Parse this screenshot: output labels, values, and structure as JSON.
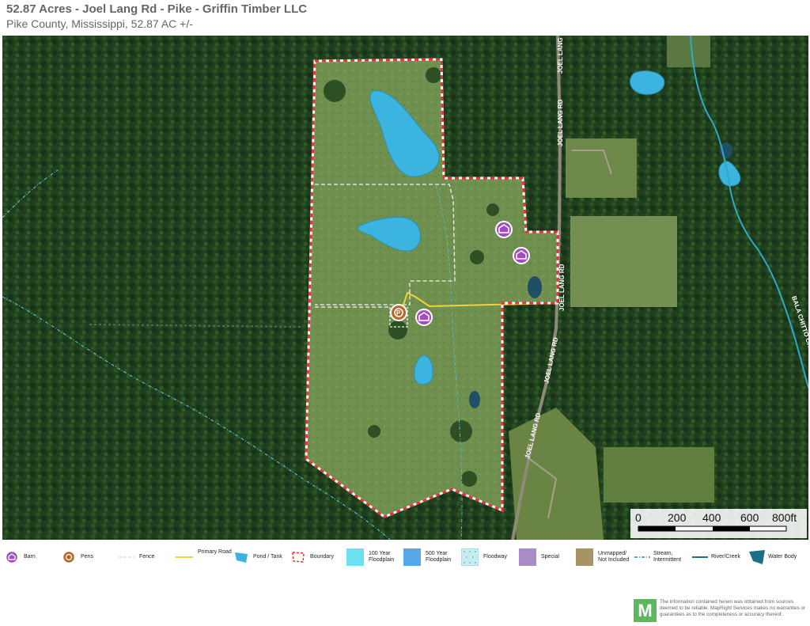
{
  "header": {
    "title": "52.87 Acres - Joel Lang Rd - Pike - Griffin Timber LLC",
    "subtitle": "Pike County, Mississippi, 52.87 AC +/-"
  },
  "map": {
    "road_labels": [
      "JOEL LANG",
      "JOEL LANG RD",
      "JOEL LANG RD",
      "JOEL LANG RD",
      "JOEL LANG RD"
    ],
    "stream_label": "BALA CHITTO CREEK",
    "scale": {
      "ticks": [
        "0",
        "200",
        "400",
        "600",
        "800ft"
      ]
    },
    "colors": {
      "boundary": "#e8323c",
      "pond": "#3cb4e0",
      "primary_road": "#f2d23c",
      "barn": "#a14dbb",
      "pens": "#b36b2c",
      "stream": "#2fa9c9"
    }
  },
  "legend": {
    "items": [
      {
        "icon": "barn-icon",
        "label": "Barn"
      },
      {
        "icon": "pens-icon",
        "label": "Pens"
      },
      {
        "icon": "fence-icon",
        "label": "Fence"
      },
      {
        "icon": "primary-road-icon",
        "label": "Primary Road"
      },
      {
        "icon": "pond-tank-icon",
        "label": "Pond / Tank"
      },
      {
        "icon": "boundary-icon",
        "label": "Boundary"
      },
      {
        "icon": "floodplain-100-icon",
        "label": "100 Year Floodplain"
      },
      {
        "icon": "floodplain-500-icon",
        "label": "500 Year Floodplain"
      },
      {
        "icon": "floodway-icon",
        "label": "Floodway"
      },
      {
        "icon": "special-icon",
        "label": "Special"
      },
      {
        "icon": "unmapped-icon",
        "label": "Unmapped/ Not Included"
      },
      {
        "icon": "stream-intermittent-icon",
        "label": "Stream, Intermittent"
      },
      {
        "icon": "river-creek-icon",
        "label": "River/Creek"
      },
      {
        "icon": "water-body-icon",
        "label": "Water Body"
      }
    ]
  },
  "footer": {
    "logo_letter": "M",
    "disclaimer": "The information contained herein was obtained from sources deemed to be reliable. MapRight Services makes no warranties or guarantees as to the completeness or accuracy thereof."
  }
}
